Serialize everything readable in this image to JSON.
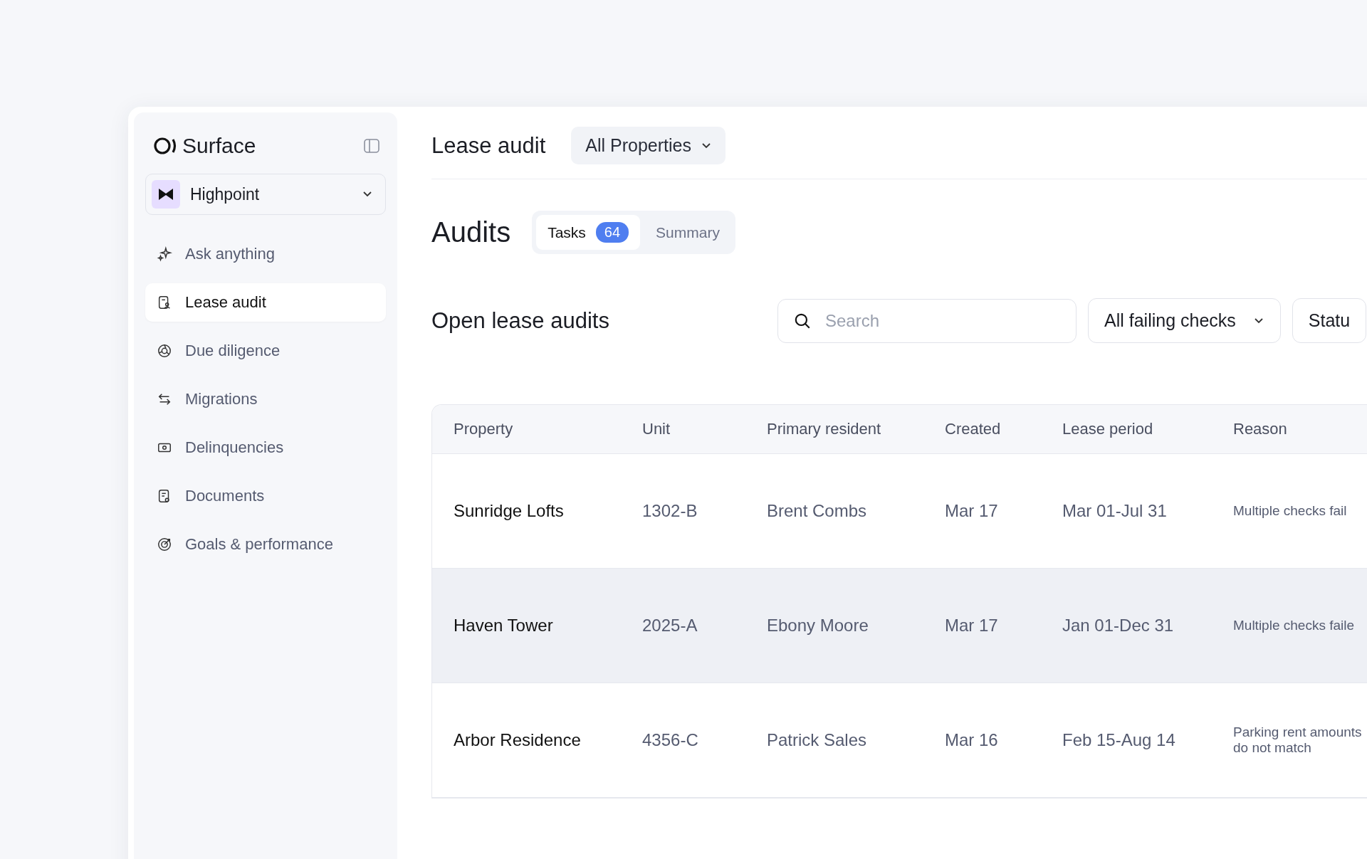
{
  "brand": {
    "name": "Surface"
  },
  "workspace": {
    "name": "Highpoint"
  },
  "nav": [
    {
      "label": "Ask anything",
      "selected": false
    },
    {
      "label": "Lease audit",
      "selected": true
    },
    {
      "label": "Due diligence",
      "selected": false
    },
    {
      "label": "Migrations",
      "selected": false
    },
    {
      "label": "Delinquencies",
      "selected": false
    },
    {
      "label": "Documents",
      "selected": false
    },
    {
      "label": "Goals & performance",
      "selected": false
    }
  ],
  "header": {
    "title": "Lease audit",
    "property_filter": "All Properties"
  },
  "section": {
    "title": "Audits",
    "tabs": [
      {
        "label": "Tasks",
        "count": "64",
        "selected": true
      },
      {
        "label": "Summary",
        "selected": false
      }
    ]
  },
  "list": {
    "title": "Open lease audits",
    "search": {
      "placeholder": "Search"
    },
    "filters": [
      {
        "label": "All failing checks",
        "kind": "dropdown"
      },
      {
        "label": "Statu",
        "kind": "dropdown"
      }
    ]
  },
  "table": {
    "columns": [
      "Property",
      "Unit",
      "Primary resident",
      "Created",
      "Lease period",
      "Reason"
    ],
    "rows": [
      {
        "selected": false,
        "cells": [
          "Sunridge Lofts",
          "1302-B",
          "Brent Combs",
          "Mar 17",
          "Mar 01-Jul 31",
          "Multiple checks fail"
        ]
      },
      {
        "selected": true,
        "cells": [
          "Haven Tower",
          "2025-A",
          "Ebony Moore",
          "Mar 17",
          "Jan 01-Dec 31",
          "Multiple checks faile"
        ]
      },
      {
        "selected": false,
        "cells": [
          "Arbor Residence",
          "4356-C",
          "Patrick Sales",
          "Mar 16",
          "Feb 15-Aug 14",
          "Parking rent amounts do not match"
        ]
      }
    ]
  }
}
